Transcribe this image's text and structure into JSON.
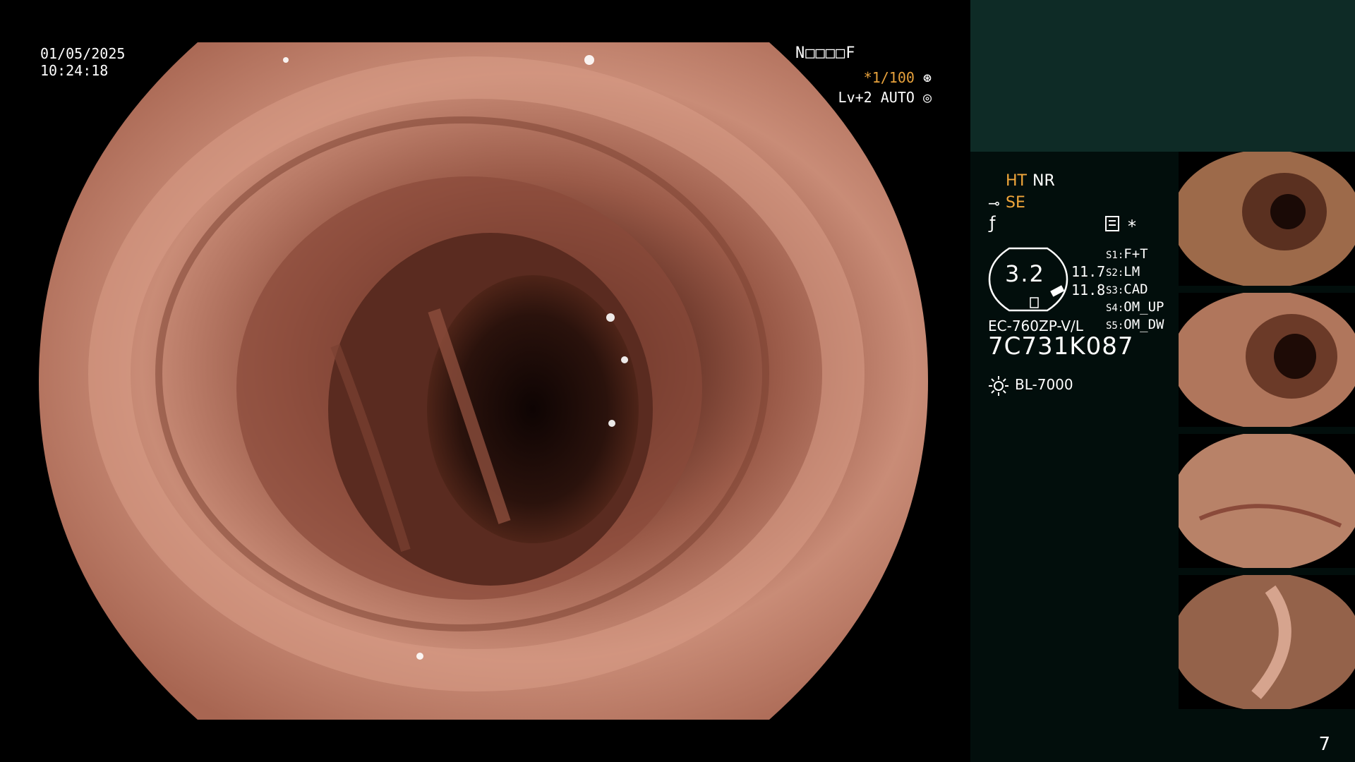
{
  "overlay": {
    "date": "01/05/2025",
    "time": "10:24:18",
    "mode_code": "N□□□□F",
    "shutter": "*1/100",
    "shutter_icon": "aperture-icon",
    "level": "Lv+2 AUTO",
    "level_icon": "iris-icon"
  },
  "panel": {
    "ht": "HT",
    "nr": "NR",
    "se": "SE",
    "se_icon": "scope-tip-icon",
    "freeze_icon": "f-icon",
    "record_icon": "record-icon",
    "star": "*",
    "gauge_value": "3.2",
    "gauge_a": "11.7",
    "gauge_b": "11.8",
    "settings": [
      {
        "key": "S1:",
        "value": "F+T"
      },
      {
        "key": "S2:",
        "value": "LM"
      },
      {
        "key": "S3:",
        "value": "CAD"
      },
      {
        "key": "S4:",
        "value": "OM_UP"
      },
      {
        "key": "S5:",
        "value": "OM_DW"
      }
    ],
    "scope_model": "EC-760ZP-V/L",
    "serial": "7C731K087",
    "light_icon": "sun-icon",
    "light_source": "BL-7000",
    "page_number": "7"
  },
  "colors": {
    "panel_top": "#0e2b26",
    "panel_main": "#020e0c",
    "accent": "#f2a73b",
    "tissue": "#b5705c"
  }
}
